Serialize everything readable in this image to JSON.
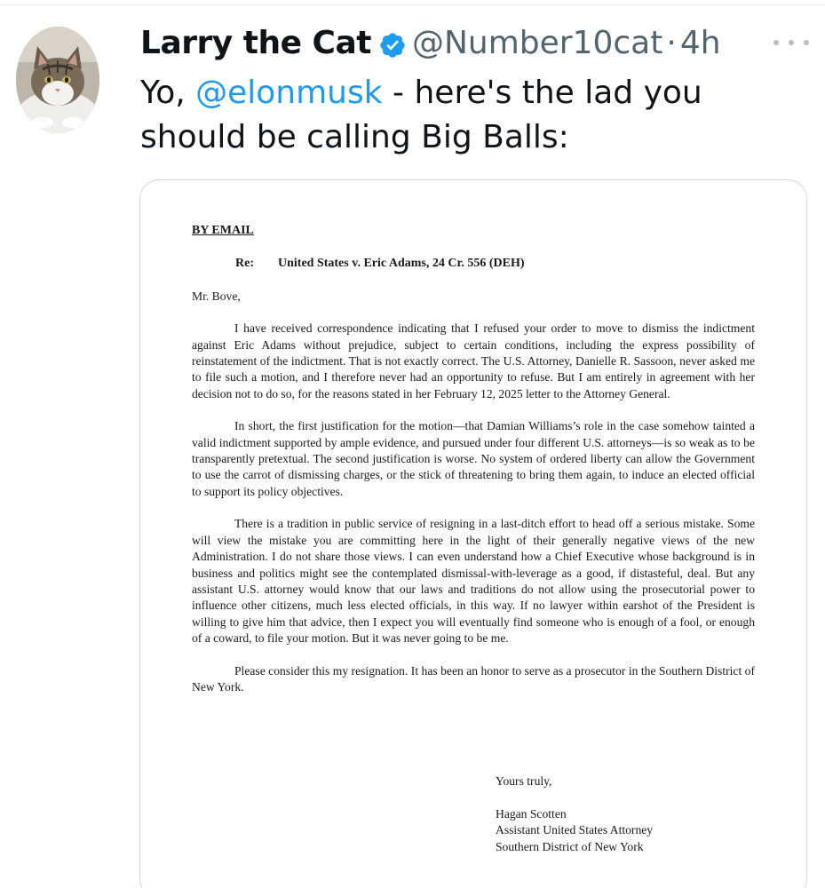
{
  "tweet": {
    "display_name": "Larry the Cat",
    "handle": "@Number10cat",
    "separator": "·",
    "time": "4h",
    "text_prefix": "Yo, ",
    "mention": "@elonmusk",
    "text_suffix": " - here's the lad you should be calling Big Balls:"
  },
  "icons": {
    "verified": "verified-badge-icon",
    "more": "more-options-icon",
    "accent": "#1d9bf0"
  },
  "letter": {
    "by_email": "BY EMAIL",
    "re_label": "Re:",
    "re_text": "United States v. Eric Adams, 24 Cr. 556 (DEH)",
    "salutation": "Mr. Bove,",
    "paragraphs": [
      "I have received correspondence indicating that I refused your order to move to dismiss the indictment against Eric Adams without prejudice, subject to certain conditions, including the express possibility of reinstatement of the indictment.  That is not exactly correct.  The U.S. Attorney, Danielle R. Sassoon, never asked me to file such a motion, and I therefore never had an opportunity to refuse.  But I am entirely in agreement with her decision not to do so, for the reasons stated in her February 12, 2025 letter to the Attorney General.",
      "In short, the first justification for the motion—that Damian Williams’s role in the case somehow tainted a valid indictment supported by ample evidence, and pursued under four different U.S. attorneys—is so weak as to be transparently pretextual.  The second justification is worse. No system of ordered liberty can allow the Government to use the carrot of dismissing charges, or the stick of threatening to bring them again, to induce an elected official to support its policy objectives.",
      "There is a tradition in public service of resigning in a last-ditch effort to head off a serious mistake.  Some will view the mistake you are committing here in the light of their generally negative views of the new Administration.  I do not share those views.  I can even understand how a Chief Executive whose background is in business and politics might see the contemplated dismissal-with-leverage as a good, if distasteful, deal.  But any assistant U.S. attorney would know that our laws and traditions do not allow using the prosecutorial power to influence other citizens, much less elected officials, in this way.  If no lawyer within earshot of the President is willing to give him that advice, then I expect you will eventually find someone who is enough of a fool, or enough of a coward, to file your motion.  But it was never going to be me.",
      "Please consider this my resignation.  It has been an honor to serve as a prosecutor in the Southern District of New York."
    ],
    "closing": "Yours truly,",
    "signer_name": "Hagan Scotten",
    "signer_title": "Assistant United States Attorney",
    "signer_office": "Southern District of New York"
  }
}
